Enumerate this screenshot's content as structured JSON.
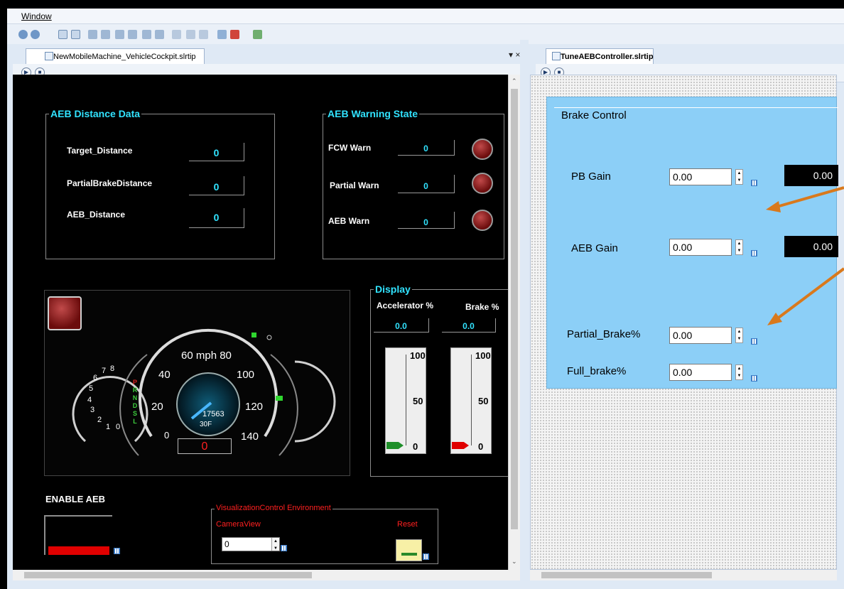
{
  "menu": {
    "window": "Window"
  },
  "tabs": {
    "left": "NewMobileMachine_VehicleCockpit.slrtip",
    "right": "TuneAEBController.slrtip",
    "controls": "▾ ×"
  },
  "aeb_distance": {
    "title": "AEB Distance Data",
    "rows": [
      {
        "label": "Target_Distance",
        "value": "0"
      },
      {
        "label": "PartialBrakeDistance",
        "value": "0"
      },
      {
        "label": "AEB_Distance",
        "value": "0"
      }
    ]
  },
  "aeb_warning": {
    "title": "AEB Warning State",
    "rows": [
      {
        "label": "FCW Warn",
        "value": "0"
      },
      {
        "label": "Partial Warn",
        "value": "0"
      },
      {
        "label": "AEB Warn",
        "value": "0"
      }
    ]
  },
  "cluster": {
    "speed_labels": [
      "20",
      "40",
      "60 mph 80",
      "100",
      "120",
      "140"
    ],
    "rpm_labels": [
      "0",
      "1",
      "2",
      "3",
      "4",
      "5",
      "6",
      "7",
      "8"
    ],
    "odometer": "17563",
    "trip": "0",
    "gear": [
      "P",
      "R",
      "N",
      "D",
      "S",
      "L"
    ],
    "temp": "30F",
    "speed_readout": "0"
  },
  "display": {
    "title": "Display",
    "accel_label": "Accelerator %",
    "brake_label": "Brake %",
    "accel_value": "0.0",
    "brake_value": "0.0",
    "gauge_max": "100",
    "gauge_mid": "50",
    "gauge_min": "0",
    "accel_level": 0,
    "brake_level": 0,
    "accel_color": "#1f8f2a",
    "brake_color": "#e00000"
  },
  "enable_aeb": {
    "label": "ENABLE AEB",
    "color": "#e00000"
  },
  "viz_env": {
    "title": "VisualizationControl Environment",
    "camera_label": "CameraView",
    "camera_value": "0",
    "reset_label": "Reset"
  },
  "brake_control": {
    "title": "Brake Control",
    "pb_gain_label": "PB Gain",
    "pb_gain_value": "0.00",
    "pb_gain_display": "0.00",
    "aeb_gain_label": "AEB Gain",
    "aeb_gain_value": "0.00",
    "aeb_gain_display": "0.00",
    "partial_label": "Partial_Brake%",
    "partial_value": "0.00",
    "full_label": "Full_brake%",
    "full_value": "0.00",
    "arrow_color": "#d9791c"
  }
}
